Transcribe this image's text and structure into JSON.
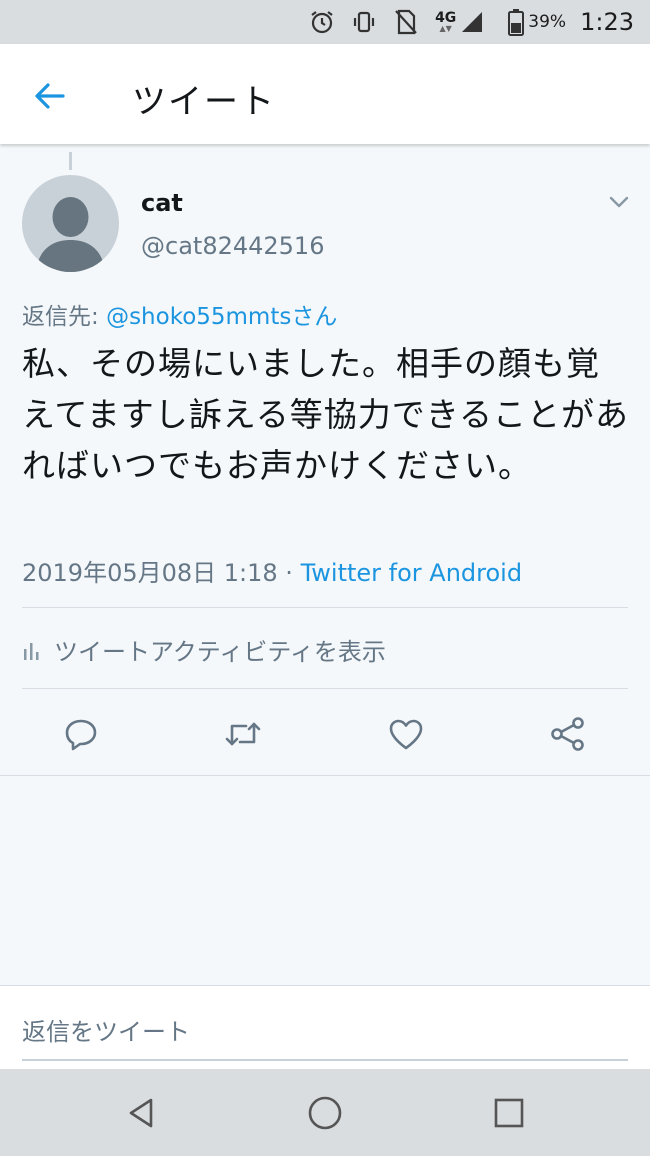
{
  "status_bar": {
    "network": "4G",
    "battery": "39%",
    "time": "1:23",
    "icons": [
      "alarm-icon",
      "vibrate-icon",
      "no-sim-icon",
      "signal-icon",
      "battery-icon"
    ]
  },
  "app_bar": {
    "title": "ツイート",
    "back_icon": "arrow-left-icon"
  },
  "tweet": {
    "name": "cat",
    "handle": "@cat82442516",
    "reply_prefix": "返信先: ",
    "reply_mention": "@shoko55mmtsさん",
    "text": "私、その場にいました。相手の顔も覚えてますし訴える等協力できることがあればいつでもお声かけください。",
    "timestamp": "2019年05月08日 1:18 · ",
    "client": "Twitter for Android",
    "activity_label": "ツイートアクティビティを表示"
  },
  "actions": [
    "reply-icon",
    "retweet-icon",
    "like-icon",
    "share-icon"
  ],
  "compose": {
    "placeholder": "返信をツイート"
  },
  "colors": {
    "accent": "#1b95e0",
    "muted": "#657786",
    "background": "#f5f8fa"
  }
}
